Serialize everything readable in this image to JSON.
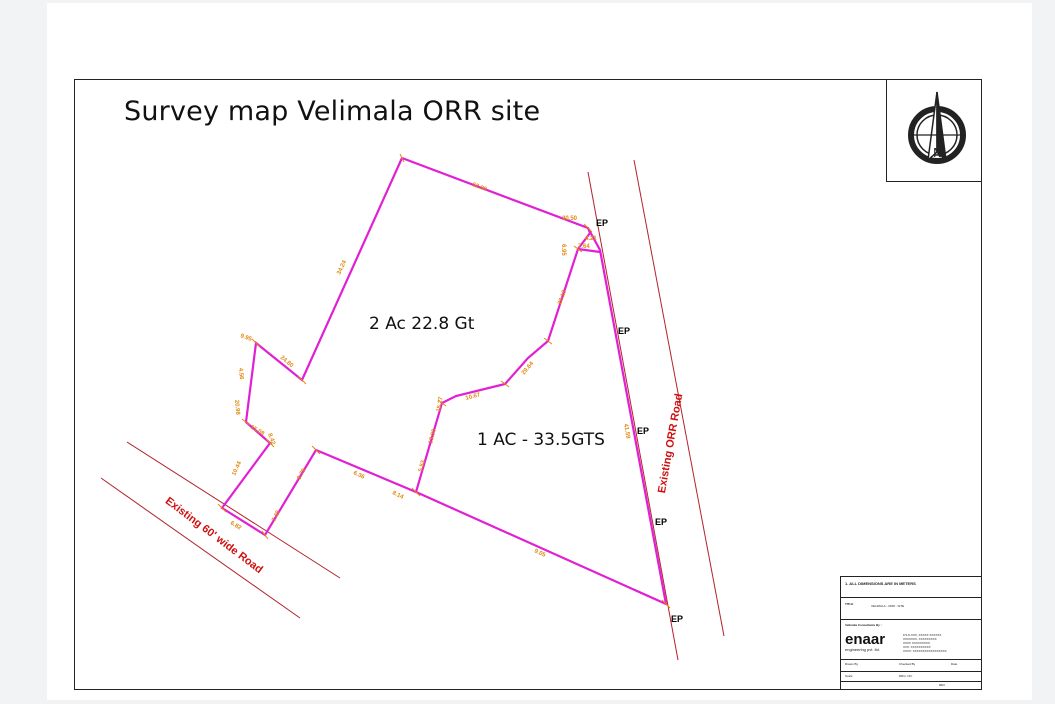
{
  "title": "Survey map Velimala ORR site",
  "areas": {
    "upper": "2 Ac  22.8 Gt",
    "lower": "1 AC - 33.5GTS"
  },
  "roads": {
    "orr": "Existing ORR Road",
    "sixty": "Existing 60' wide Road"
  },
  "edge_points": [
    "EP",
    "EP",
    "EP",
    "EP",
    "EP"
  ],
  "compass": {
    "north": "N"
  },
  "title_block": {
    "note": "1. ALL DIMENSIONS ARE IN METERS",
    "title_label": "TITLE",
    "title_value": "VELIMALA - ORR - SITE",
    "prepared_by": "Velimala Consultants By :",
    "brand": "enaar",
    "brand_sub": "engineering pvt. ltd.",
    "address": [
      "# 5-9-XXX, XXXXX XXXXXX",
      "XXXXXXX, XXXXXXXXX",
      "XXXX XXXXXXXXX",
      "XXX: XXXXXXXXXX",
      "XXXX: XXXXXXXXXXXXXXXXX"
    ],
    "drawn_by": "Drawn By",
    "checked_by": "Checked By",
    "date": "Date",
    "scale": "Scale",
    "drg_no": "DRG. NO.",
    "rev": "REV"
  },
  "colors": {
    "boundary": "#e11fd3",
    "road": "#b2232b",
    "dimension": "#e08a10",
    "road_label": "#d01010"
  },
  "dimension_labels": [
    "52.90",
    "20.50",
    "6.95",
    "4.21",
    "34.24",
    "20.18",
    "9.95",
    "24.80",
    "4.56",
    "29.64",
    "10.67",
    "20.98",
    "15.27",
    "13.30",
    "41.59",
    "15.08",
    "8.42",
    "5.53",
    "6.36",
    "10.44",
    "8.14",
    "8.79",
    "7.49",
    "6.82",
    "9.05",
    "7.64"
  ]
}
